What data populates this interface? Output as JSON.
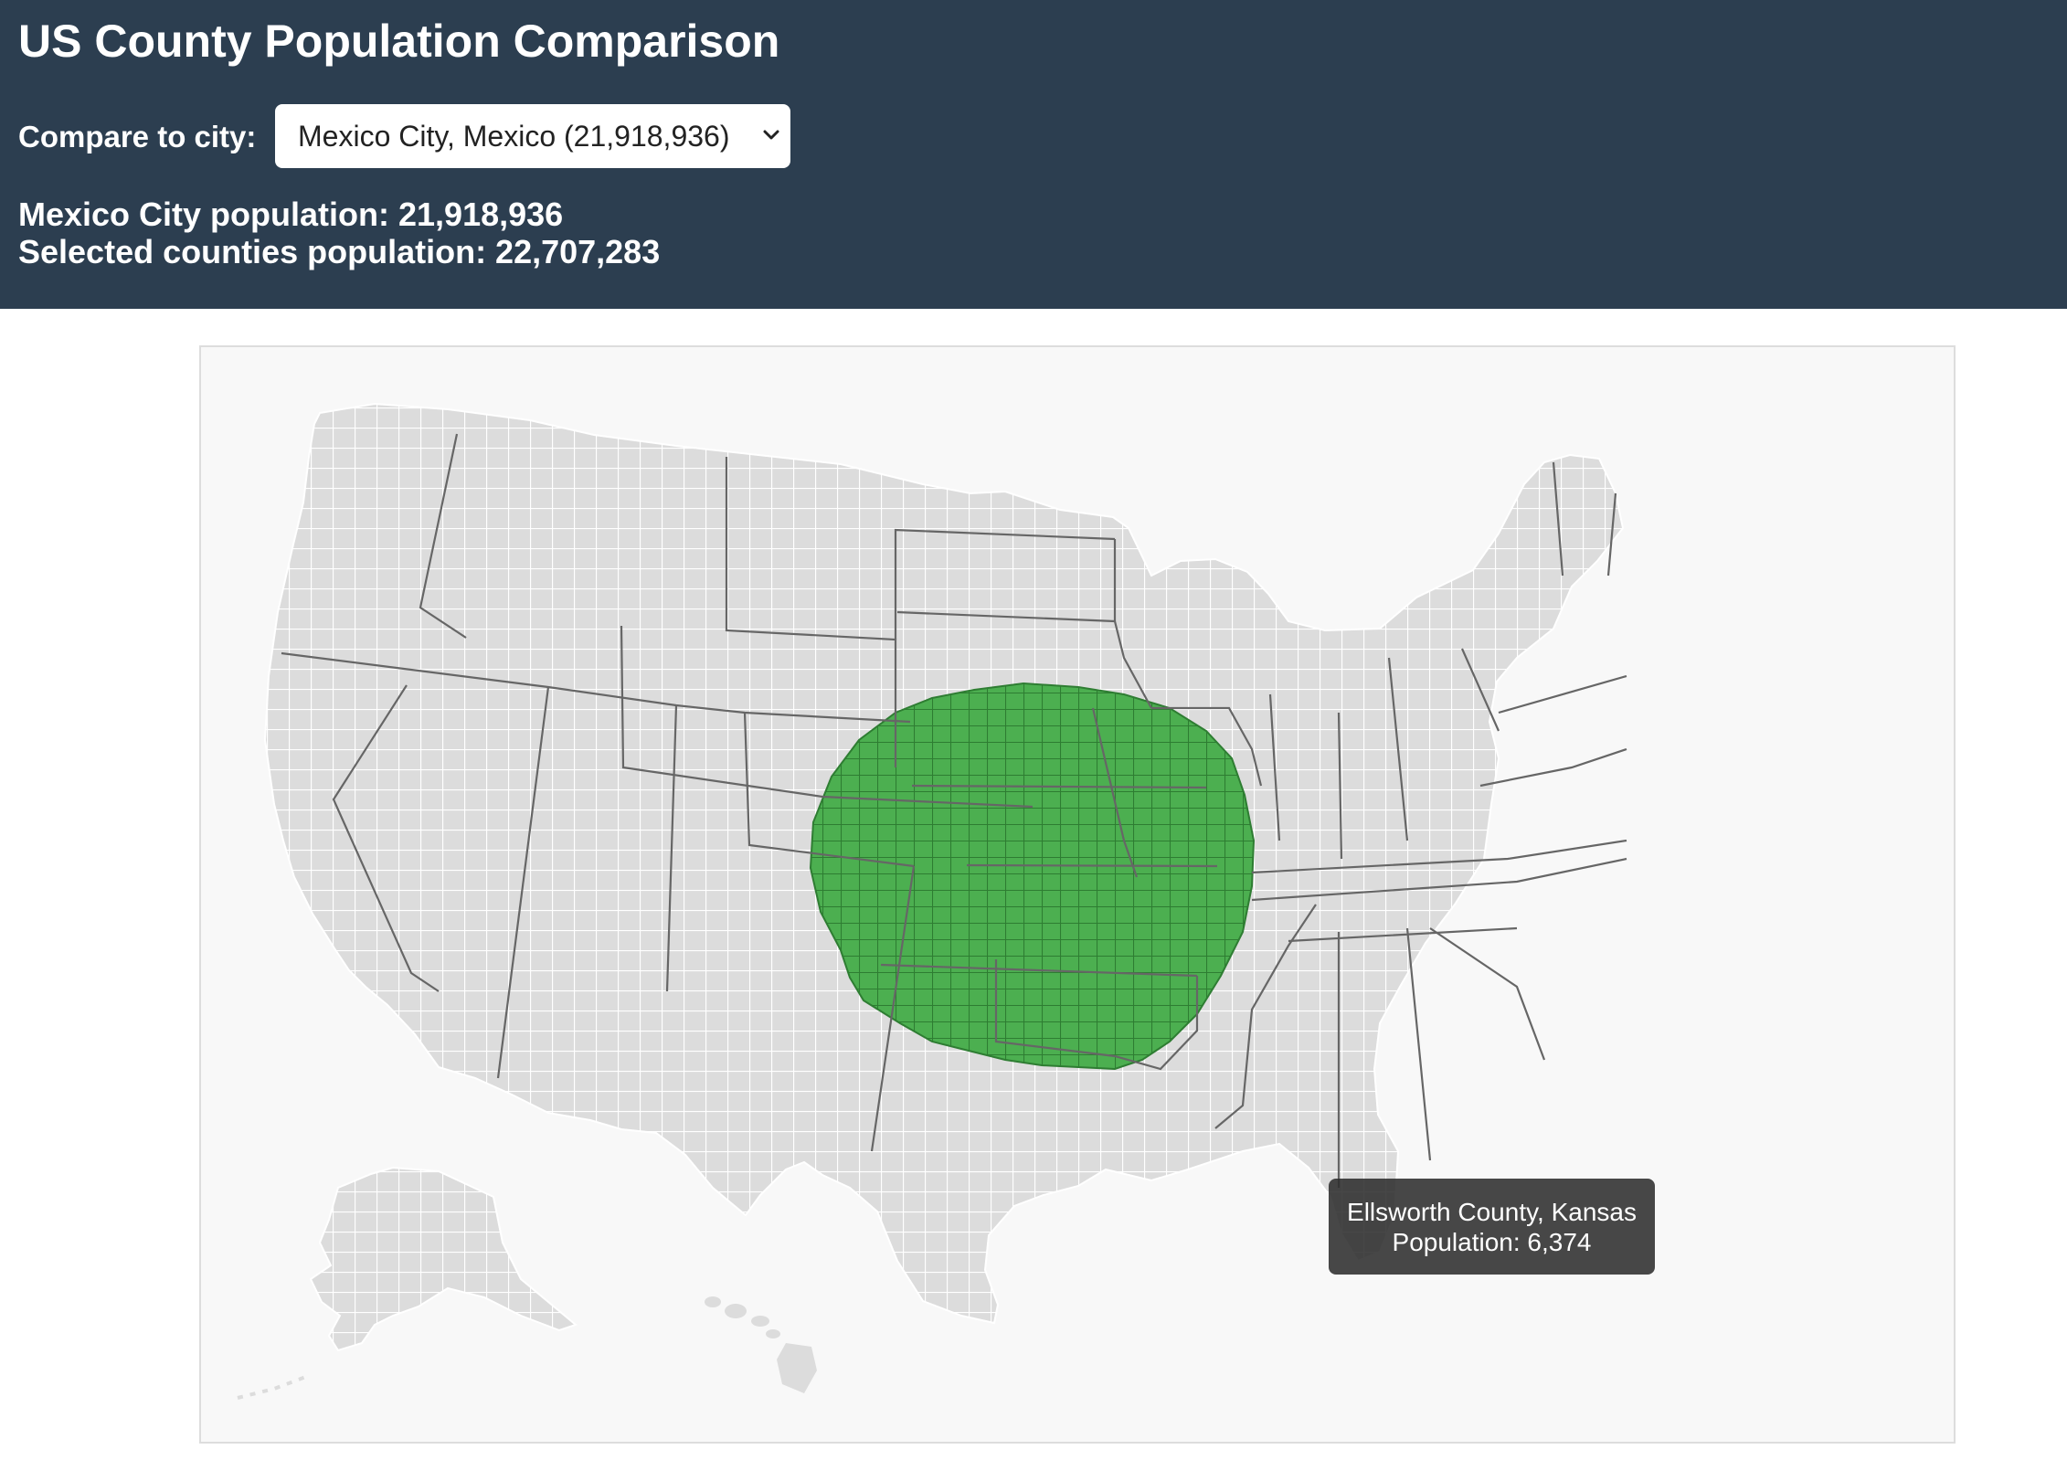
{
  "header": {
    "title": "US County Population Comparison",
    "compare_label": "Compare to city:",
    "city_select": {
      "selected": "Mexico City, Mexico (21,918,936)"
    },
    "city_population_text": "Mexico City population: 21,918,936",
    "selected_population_text": "Selected counties population: 22,707,283"
  },
  "map": {
    "colors": {
      "background": "#f8f8f8",
      "county_fill": "#dcdcdc",
      "county_border": "#ffffff",
      "state_border": "#666666",
      "selected_fill": "#4caf50",
      "selected_border": "#2e7d32"
    },
    "tooltip": {
      "county": "Ellsworth County, Kansas",
      "population": "Population: 6,374"
    }
  }
}
